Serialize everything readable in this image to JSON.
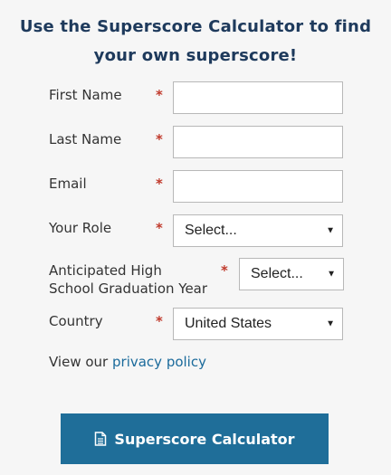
{
  "heading": {
    "line1": "Use the Superscore Calculator to find",
    "line2": "your own superscore!"
  },
  "form": {
    "required_mark": "*",
    "first_name": {
      "label": "First Name",
      "value": ""
    },
    "last_name": {
      "label": "Last Name",
      "value": ""
    },
    "email": {
      "label": "Email",
      "value": ""
    },
    "role": {
      "label": "Your Role",
      "selected": "Select..."
    },
    "grad_year": {
      "label_line1": "Anticipated High",
      "label_line2": "School Graduation Year",
      "selected": "Select..."
    },
    "country": {
      "label": "Country",
      "selected": "United States"
    },
    "privacy_prefix": "View our",
    "privacy_link": "privacy policy"
  },
  "submit": {
    "label": "Superscore Calculator",
    "icon": "document-icon"
  },
  "colors": {
    "heading": "#1e3a5c",
    "required": "#c0392b",
    "link": "#1a6a9b",
    "button": "#1f6e99",
    "background": "#f6f6f6"
  }
}
